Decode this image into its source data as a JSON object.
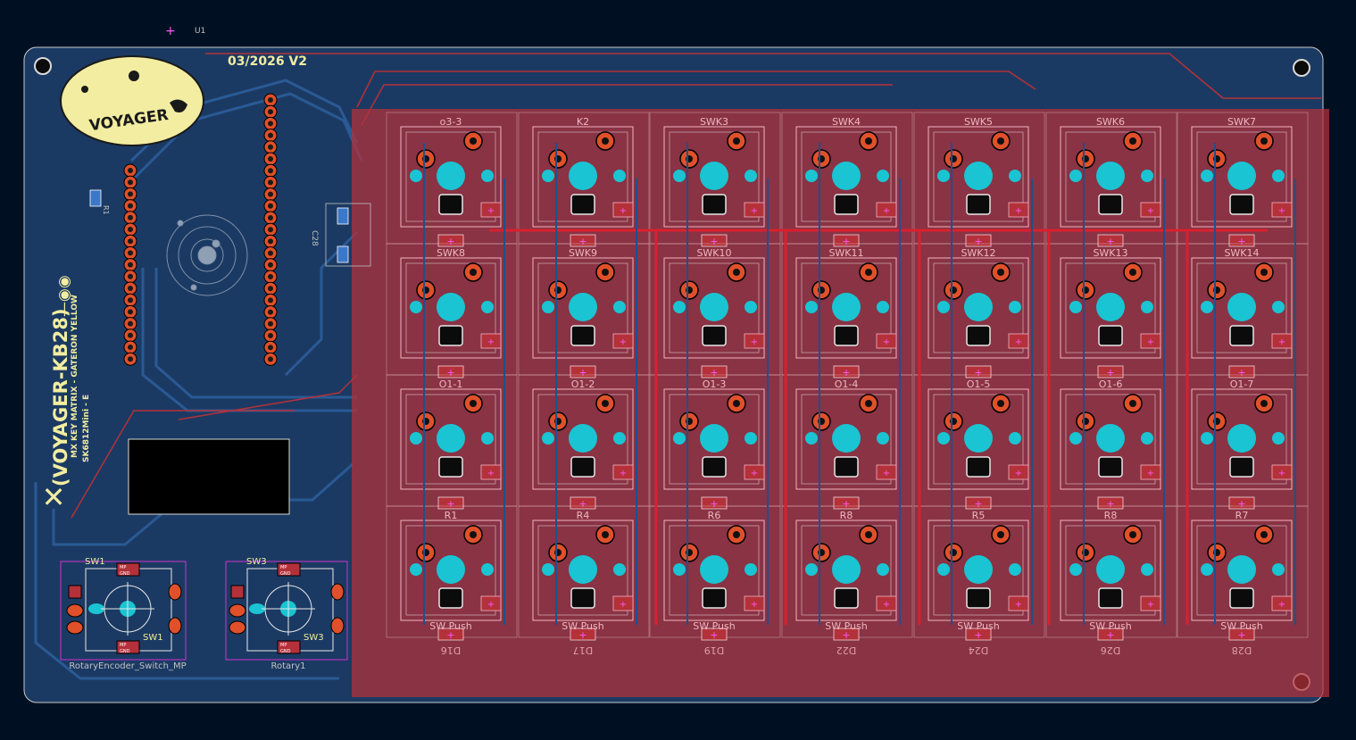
{
  "board": {
    "date_version": "03/2026 V2",
    "logo_text": "VOYAGER",
    "title": "(VOYAGER-KB28)",
    "subtitle1": "MX KEY MATRIX - GATERON YELLOW",
    "subtitle2": "SK6812Mini - E",
    "u1_label": "U1",
    "c_labels": [
      "C28",
      "R1"
    ]
  },
  "keys": {
    "top_labels": [
      "o3-3",
      "K2",
      "SWK3",
      "SWK4",
      "SWK5",
      "SWK6",
      "SWK7"
    ],
    "row2_labels": [
      "SWK8",
      "SWK9",
      "SWK10",
      "SWK11",
      "SWK12",
      "SWK13",
      "SWK14"
    ],
    "row3_labels": [
      "O1-1",
      "O1-2",
      "O1-3",
      "O1-4",
      "O1-5",
      "O1-6",
      "O1-7"
    ],
    "row4_labels": [
      "R1",
      "R4",
      "R6",
      "R8",
      "R5",
      "R8",
      "R7"
    ],
    "push_label": "SW Push",
    "diode_labels": [
      "D16",
      "D17",
      "D19",
      "D22",
      "D24",
      "D26",
      "D28"
    ]
  },
  "encoders": {
    "sw1_ref": "SW1",
    "sw1_value": "RotaryEncoder_Switch_MP",
    "sw3_ref": "SW3",
    "sw3_value": "Rotary1",
    "pad_labels": [
      "MP",
      "GND"
    ]
  },
  "colors": {
    "background": "#001023",
    "board_fill": "#1b3a63",
    "copper_fill": "#b4313a",
    "pad": "#1ac4d2",
    "silk": "#f2eda1",
    "fab": "#e0a0a8"
  }
}
